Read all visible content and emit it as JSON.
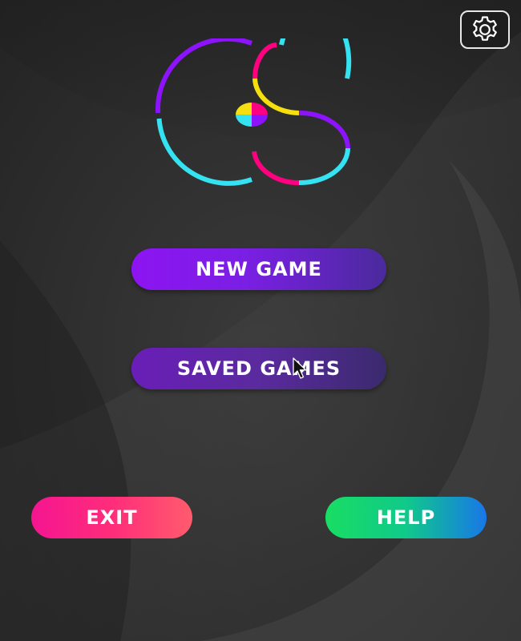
{
  "menu": {
    "new_game_label": "NEW GAME",
    "saved_games_label": "SAVED GAMES",
    "exit_label": "EXIT",
    "help_label": "HELP"
  },
  "icons": {
    "settings": "gear-icon",
    "logo": "color-switch-logo",
    "cursor": "mouse-pointer"
  },
  "colors": {
    "background": "#2b2b2b",
    "logo_purple": "#8c13fb",
    "logo_cyan": "#35e2f2",
    "logo_magenta": "#ff0080",
    "logo_yellow": "#f6df0e",
    "new_game": "#8d14f2",
    "saved_games": "#5a2a9e",
    "exit": "#ff2d7a",
    "help": "#10c98a"
  }
}
